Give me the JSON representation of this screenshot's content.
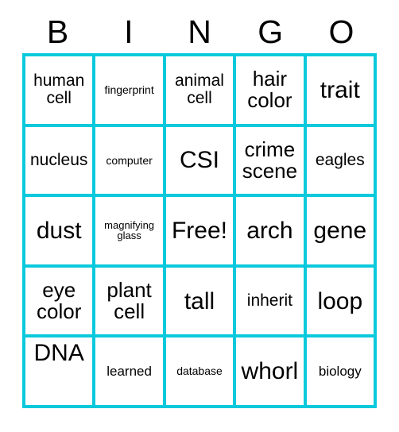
{
  "card": {
    "title": "BINGO",
    "accent_color": "#0bc9dc",
    "text_color": "#000000",
    "background_color": "#ffffff",
    "columns": 5,
    "rows": 5,
    "header": {
      "letters": [
        "B",
        "I",
        "N",
        "G",
        "O"
      ]
    },
    "free_space": {
      "label": "Free!",
      "row": 3,
      "column": 3
    },
    "grid": [
      [
        {
          "text": "human cell",
          "size": "md",
          "align": "center"
        },
        {
          "text": "fingerprint",
          "size": "xs",
          "align": "center"
        },
        {
          "text": "animal cell",
          "size": "md",
          "align": "center"
        },
        {
          "text": "hair color",
          "size": "lg",
          "align": "center"
        },
        {
          "text": "trait",
          "size": "xl",
          "align": "center"
        }
      ],
      [
        {
          "text": "nucleus",
          "size": "md",
          "align": "center"
        },
        {
          "text": "computer",
          "size": "xs",
          "align": "center"
        },
        {
          "text": "CSI",
          "size": "xl",
          "align": "center"
        },
        {
          "text": "crime scene",
          "size": "lg",
          "align": "center"
        },
        {
          "text": "eagles",
          "size": "md",
          "align": "center"
        }
      ],
      [
        {
          "text": "dust",
          "size": "xl",
          "align": "center"
        },
        {
          "text": "magnifying glass",
          "size": "xxs",
          "align": "center"
        },
        {
          "text": "Free!",
          "size": "xl",
          "align": "center"
        },
        {
          "text": "arch",
          "size": "xl",
          "align": "center"
        },
        {
          "text": "gene",
          "size": "xl",
          "align": "center"
        }
      ],
      [
        {
          "text": "eye color",
          "size": "lg",
          "align": "center"
        },
        {
          "text": "plant cell",
          "size": "lg",
          "align": "center"
        },
        {
          "text": "tall",
          "size": "xl",
          "align": "center"
        },
        {
          "text": "inherit",
          "size": "md",
          "align": "center"
        },
        {
          "text": "loop",
          "size": "xl",
          "align": "center"
        }
      ],
      [
        {
          "text": "DNA",
          "size": "xl",
          "align": "top"
        },
        {
          "text": "learned",
          "size": "sm",
          "align": "center"
        },
        {
          "text": "database",
          "size": "xs",
          "align": "center"
        },
        {
          "text": "whorl",
          "size": "xl",
          "align": "center"
        },
        {
          "text": "biology",
          "size": "sm",
          "align": "center"
        }
      ]
    ]
  }
}
